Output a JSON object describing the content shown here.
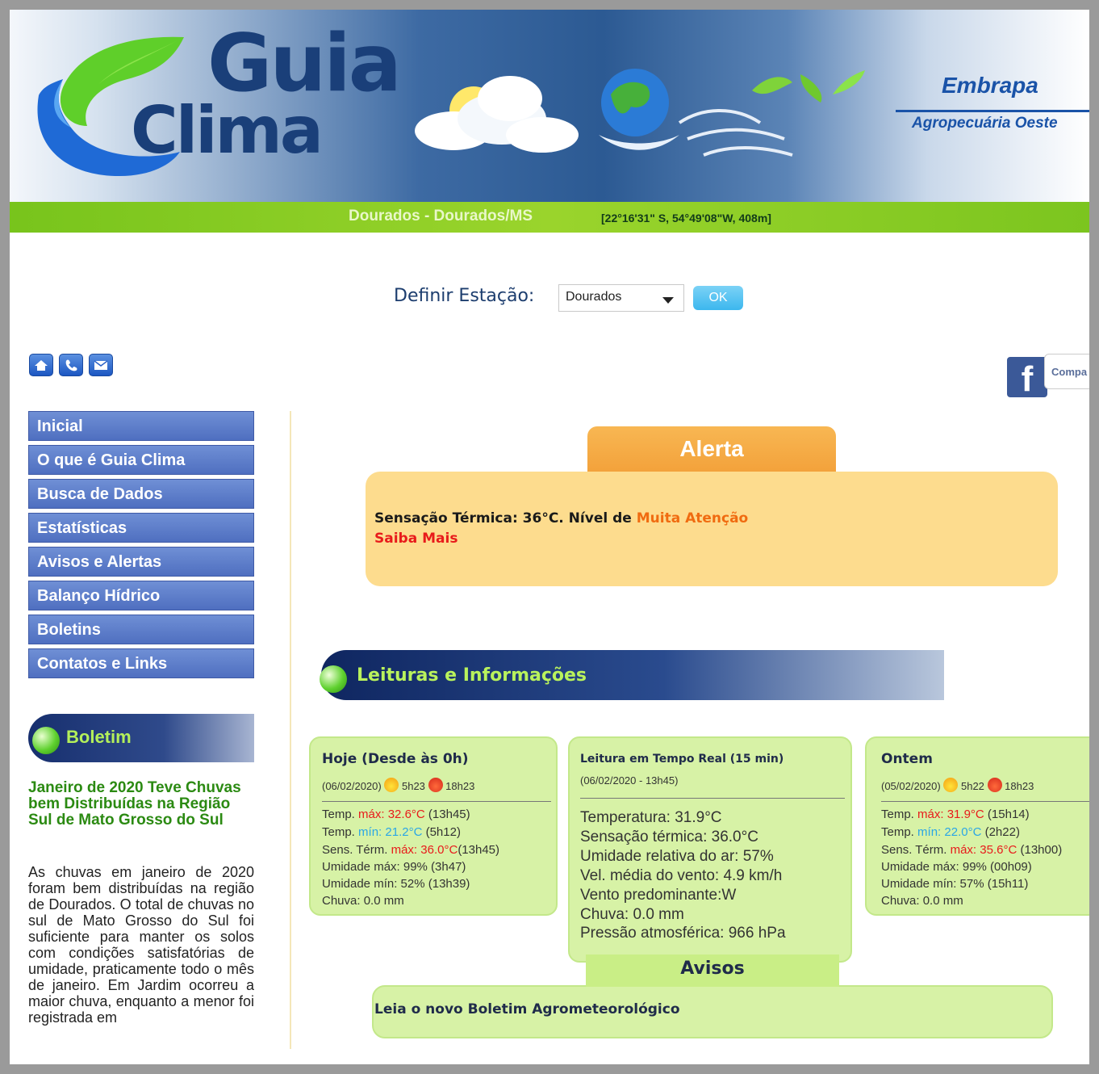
{
  "header": {
    "logo_line1": "Guia",
    "logo_line2": "Clima",
    "partner_logo": "Embrapa",
    "partner_unit": "Agropecuária Oeste",
    "location": "Dourados - Dourados/MS",
    "coordinates": "[22°16'31\" S, 54°49'08\"W, 408m]"
  },
  "station": {
    "label": "Definir Estação:",
    "selected": "Dourados",
    "ok_label": "OK"
  },
  "toolbar": {
    "icons": [
      "home-icon",
      "phone-icon",
      "mail-icon"
    ]
  },
  "social": {
    "facebook_letter": "f",
    "share_label": "Compa"
  },
  "menu": {
    "items": [
      {
        "label": "Inicial"
      },
      {
        "label": "O que é Guia Clima"
      },
      {
        "label": "Busca de Dados"
      },
      {
        "label": "Estatísticas"
      },
      {
        "label": "Avisos e Alertas"
      },
      {
        "label": "Balanço Hídrico"
      },
      {
        "label": "Boletins"
      },
      {
        "label": "Contatos e Links"
      }
    ]
  },
  "boletim": {
    "heading": "Boletim",
    "news_title": "Janeiro de 2020 Teve Chuvas bem Distribuídas na Região Sul de Mato Grosso do Sul",
    "news_text": "As chuvas em janeiro de 2020 foram bem distribuídas na região de Dourados. O total de chuvas no sul de Mato Grosso do Sul foi suficiente para manter os solos com condições satisfatórias de umidade, praticamente todo o mês de janeiro. Em Jardim ocorreu a maior chuva, enquanto a menor foi registrada em"
  },
  "alerta": {
    "title": "Alerta",
    "message": "Sensação Térmica: 36°C. Nível de ",
    "level": "Muita Atenção",
    "link": "Saiba Mais"
  },
  "leituras": {
    "heading": "Leituras e Informações",
    "hoje": {
      "title": "Hoje (Desde às 0h)",
      "date": "(06/02/2020)",
      "sunrise": "5h23",
      "sunset": "18h23",
      "temp_max_label": "Temp.",
      "temp_max_kw": "máx:",
      "temp_max_value": "32.6°C",
      "temp_max_time": "(13h45)",
      "temp_min_label": "Temp.",
      "temp_min_kw": "mín:",
      "temp_min_value": "21.2°C",
      "temp_min_time": "(5h12)",
      "sens_label": "Sens. Térm.",
      "sens_kw": "máx:",
      "sens_value": "36.0°C",
      "sens_time": "(13h45)",
      "umid_max": "Umidade máx: 99% (3h47)",
      "umid_min": "Umidade mín: 52% (13h39)",
      "chuva": "Chuva: 0.0 mm"
    },
    "tempo_real": {
      "title": "Leitura em Tempo Real (15 min)",
      "date": "(06/02/2020 - 13h45)",
      "lines": [
        "Temperatura: 31.9°C",
        "Sensação térmica: 36.0°C",
        "Umidade relativa do ar: 57%",
        "Vel. média do vento: 4.9 km/h",
        "Vento predominante:W",
        "Chuva: 0.0 mm",
        "Pressão atmosférica: 966 hPa"
      ]
    },
    "ontem": {
      "title": "Ontem",
      "date": "(05/02/2020)",
      "sunrise": "5h22",
      "sunset": "18h23",
      "temp_max_label": "Temp.",
      "temp_max_kw": "máx:",
      "temp_max_value": "31.9°C",
      "temp_max_time": "(15h14)",
      "temp_min_label": "Temp.",
      "temp_min_kw": "mín:",
      "temp_min_value": "22.0°C",
      "temp_min_time": "(2h22)",
      "sens_label": "Sens. Térm.",
      "sens_kw": "máx:",
      "sens_value": "35.6°C",
      "sens_time": "(13h00)",
      "umid_max": "Umidade máx: 99% (00h09)",
      "umid_min": "Umidade mín: 57% (15h11)",
      "chuva": "Chuva: 0.0 mm"
    }
  },
  "avisos": {
    "title": "Avisos",
    "text": "Leia o novo Boletim Agrometeorológico"
  },
  "colors": {
    "menu_blue": "#5b7bc9",
    "header_green": "#8ccd25",
    "alert_orange": "#f5a83f",
    "panel_green": "#d7f2a6"
  }
}
